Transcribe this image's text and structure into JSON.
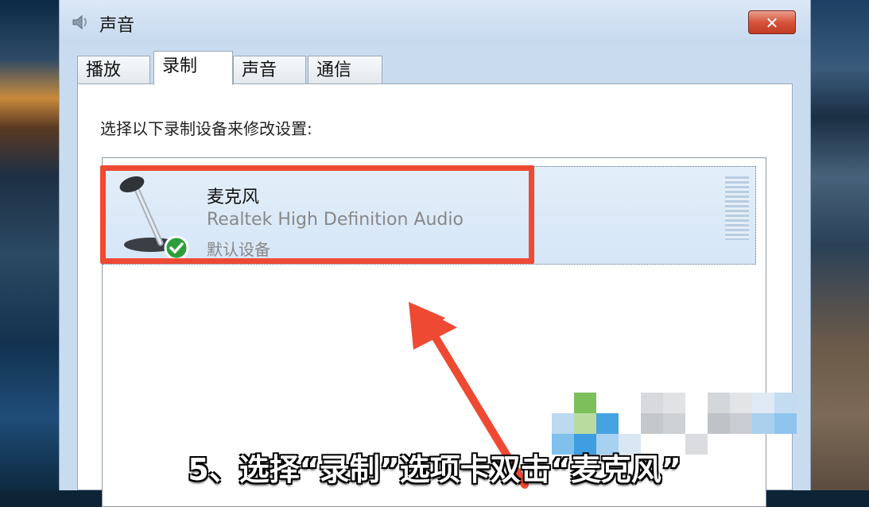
{
  "window": {
    "title": "声音",
    "close_label": "✕"
  },
  "tabs": [
    {
      "label": "播放",
      "active": false
    },
    {
      "label": "录制",
      "active": true
    },
    {
      "label": "声音",
      "active": false
    },
    {
      "label": "通信",
      "active": false
    }
  ],
  "panel": {
    "instruction": "选择以下录制设备来修改设置:"
  },
  "devices": [
    {
      "name": "麦克风",
      "driver": "Realtek High Definition Audio",
      "status": "默认设备",
      "icon": "microphone-icon",
      "badge_icon": "checkmark-icon"
    }
  ],
  "overlay": {
    "caption": "5、选择“录制”选项卡双击“麦克风”",
    "highlight_color": "#ee4a33",
    "arrow_color": "#ee4a33"
  }
}
